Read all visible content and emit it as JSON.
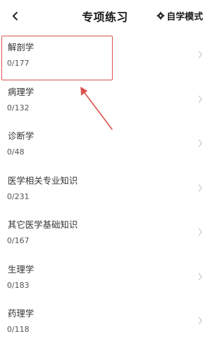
{
  "header": {
    "title": "专项练习",
    "mode_label": "自学模式",
    "back_icon": "back-chevron-icon",
    "mode_icon": "gear-icon"
  },
  "items": [
    {
      "title": "解剖学",
      "count": "0/177"
    },
    {
      "title": "病理学",
      "count": "0/132"
    },
    {
      "title": "诊断学",
      "count": "0/48"
    },
    {
      "title": "医学相关专业知识",
      "count": "0/231"
    },
    {
      "title": "其它医学基础知识",
      "count": "0/167"
    },
    {
      "title": "生理学",
      "count": "0/183"
    },
    {
      "title": "药理学",
      "count": "0/118"
    }
  ],
  "annotation": {
    "color": "#d9534f"
  }
}
